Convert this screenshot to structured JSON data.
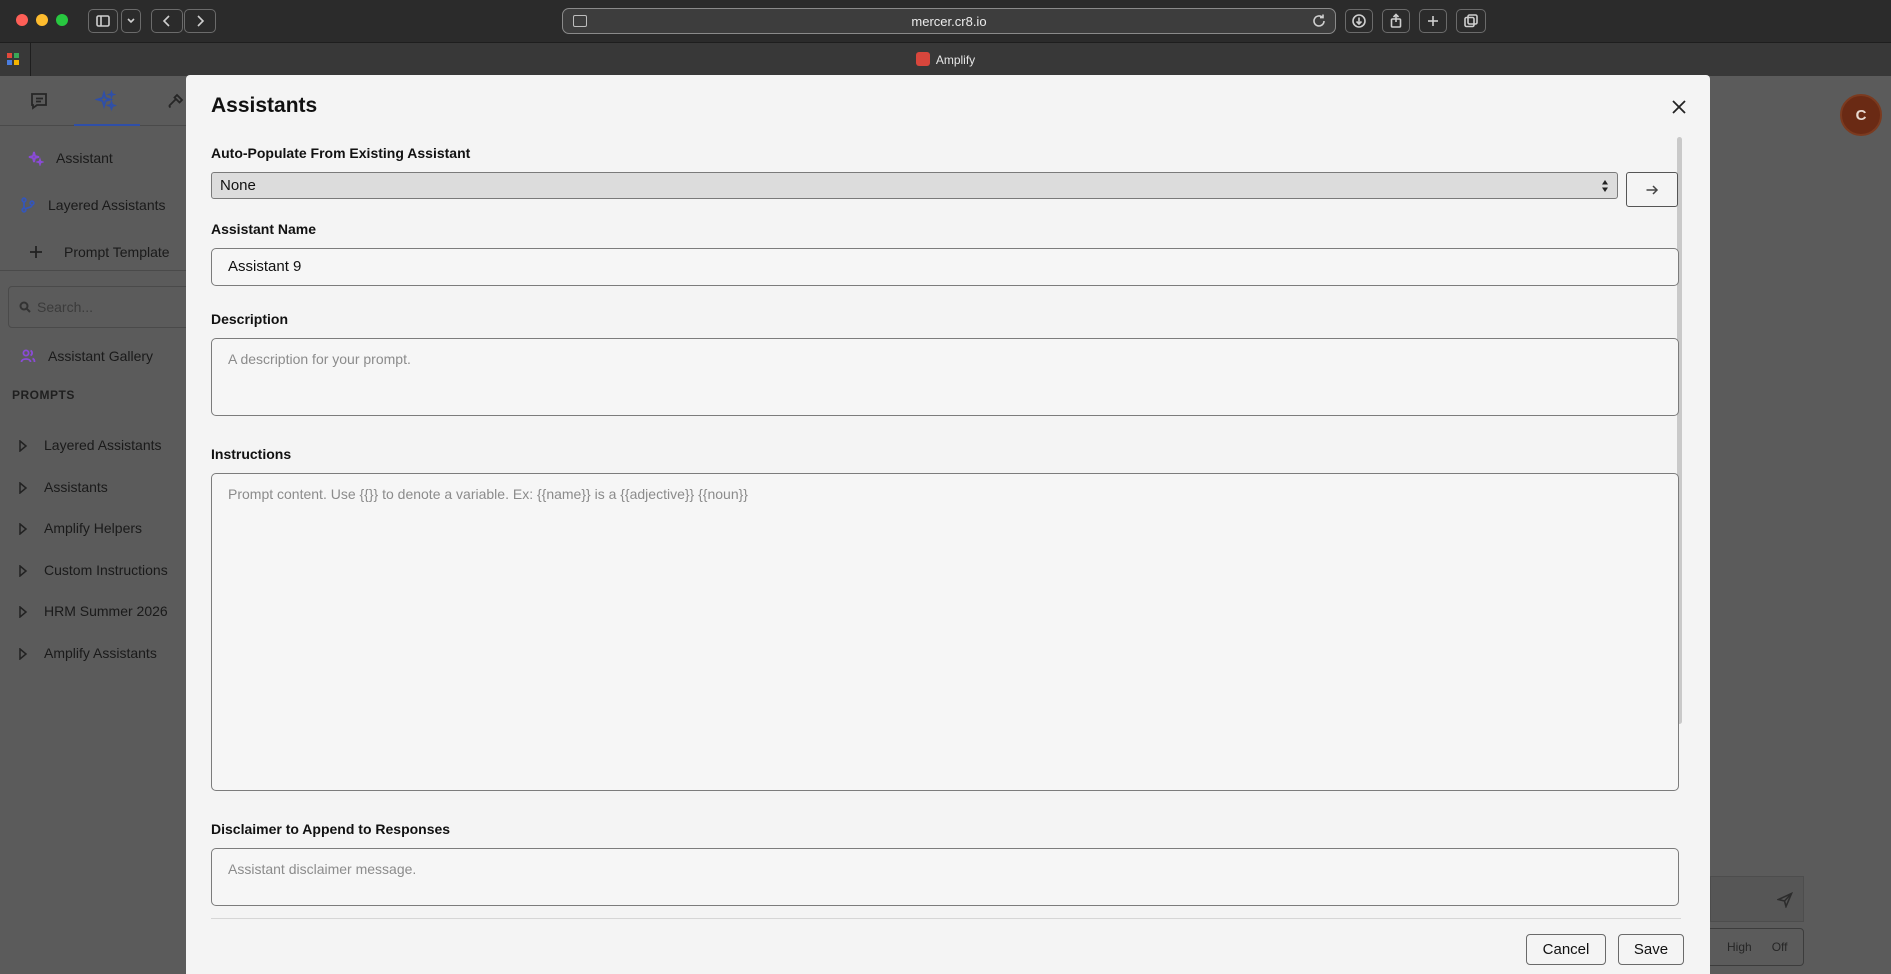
{
  "browser": {
    "url": "mercer.cr8.io",
    "tab_title": "Amplify"
  },
  "sidebar": {
    "items": [
      {
        "label": "Assistant"
      },
      {
        "label": "Layered Assistants"
      },
      {
        "label": "Prompt Template"
      }
    ],
    "search_placeholder": "Search...",
    "gallery_label": "Assistant Gallery",
    "section_title": "PROMPTS",
    "folders": [
      {
        "label": "Layered Assistants"
      },
      {
        "label": "Assistants"
      },
      {
        "label": "Amplify Helpers"
      },
      {
        "label": "Custom Instructions"
      },
      {
        "label": "HRM Summer 2026"
      },
      {
        "label": "Amplify Assistants"
      }
    ]
  },
  "avatar_initial": "C",
  "mode": {
    "high": "High",
    "off": "Off"
  },
  "modal": {
    "title": "Assistants",
    "autopopulate_label": "Auto-Populate From Existing Assistant",
    "autopopulate_value": "None",
    "name_label": "Assistant Name",
    "name_value": "Assistant 9",
    "description_label": "Description",
    "description_placeholder": "A description for your prompt.",
    "instructions_label": "Instructions",
    "instructions_placeholder": "Prompt content. Use {{}} to denote a variable. Ex: {{name}} is a {{adjective}} {{noun}}",
    "disclaimer_label": "Disclaimer to Append to Responses",
    "disclaimer_placeholder": "Assistant disclaimer message.",
    "cancel_label": "Cancel",
    "save_label": "Save"
  },
  "colors": {
    "accent_blue": "#2f4fa8",
    "avatar_bg": "#6a2a14",
    "icon_purple": "#8a4bd6",
    "icon_blue": "#3556b8"
  }
}
